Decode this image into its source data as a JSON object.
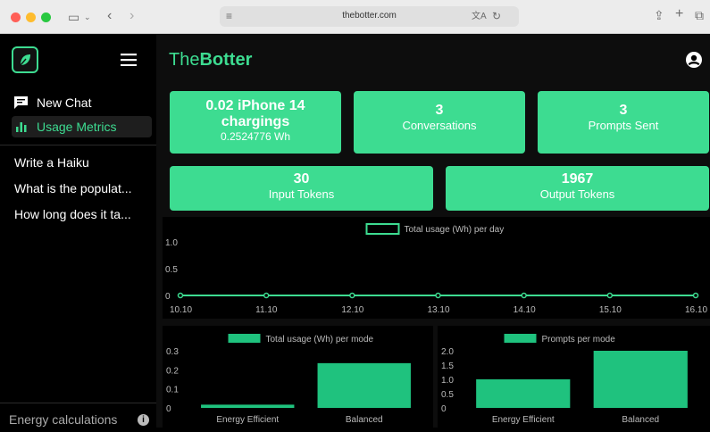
{
  "browser": {
    "url": "thebotter.com"
  },
  "brand": {
    "prefix": "The",
    "bold": "Botter"
  },
  "sidebar": {
    "nav": [
      {
        "label": "New Chat",
        "icon": "chat-icon"
      },
      {
        "label": "Usage Metrics",
        "icon": "bar-chart-icon"
      }
    ],
    "history": [
      "Write a Haiku",
      "What is the populat...",
      "How long does it ta..."
    ],
    "footer_label": "Energy calculations"
  },
  "cards": {
    "equivalent_value": "0.02 iPhone 14",
    "equivalent_value2": "chargings",
    "equivalent_sub": "0.2524776 Wh",
    "conversations_value": "3",
    "conversations_label": "Conversations",
    "prompts_value": "3",
    "prompts_label": "Prompts Sent",
    "input_value": "30",
    "input_label": "Input Tokens",
    "output_value": "1967",
    "output_label": "Output Tokens"
  },
  "colors": {
    "accent": "#3ddc91",
    "bar": "#1fc27e"
  },
  "chart_data": [
    {
      "type": "line",
      "title": "Total usage (Wh) per day",
      "x": [
        "10.10",
        "11.10",
        "12.10",
        "13.10",
        "14.10",
        "15.10",
        "16.10"
      ],
      "series": [
        {
          "name": "Total usage (Wh) per day",
          "values": [
            0,
            0,
            0,
            0,
            0,
            0,
            0
          ]
        }
      ],
      "ylim": [
        0,
        1.0
      ],
      "yticks": [
        "1.0",
        "0.5",
        "0"
      ],
      "legend": "top-center"
    },
    {
      "type": "bar",
      "title": "Total usage (Wh) per mode",
      "categories": [
        "Energy Efficient",
        "Balanced"
      ],
      "values": [
        0.017,
        0.235
      ],
      "ylim": [
        0,
        0.3
      ],
      "yticks": [
        "0.3",
        "0.2",
        "0.1",
        "0"
      ],
      "legend": "top-center"
    },
    {
      "type": "bar",
      "title": "Prompts per mode",
      "categories": [
        "Energy Efficient",
        "Balanced"
      ],
      "values": [
        1,
        2
      ],
      "ylim": [
        0,
        2.0
      ],
      "yticks": [
        "2.0",
        "1.5",
        "1.0",
        "0.5",
        "0"
      ],
      "legend": "top-center"
    }
  ]
}
